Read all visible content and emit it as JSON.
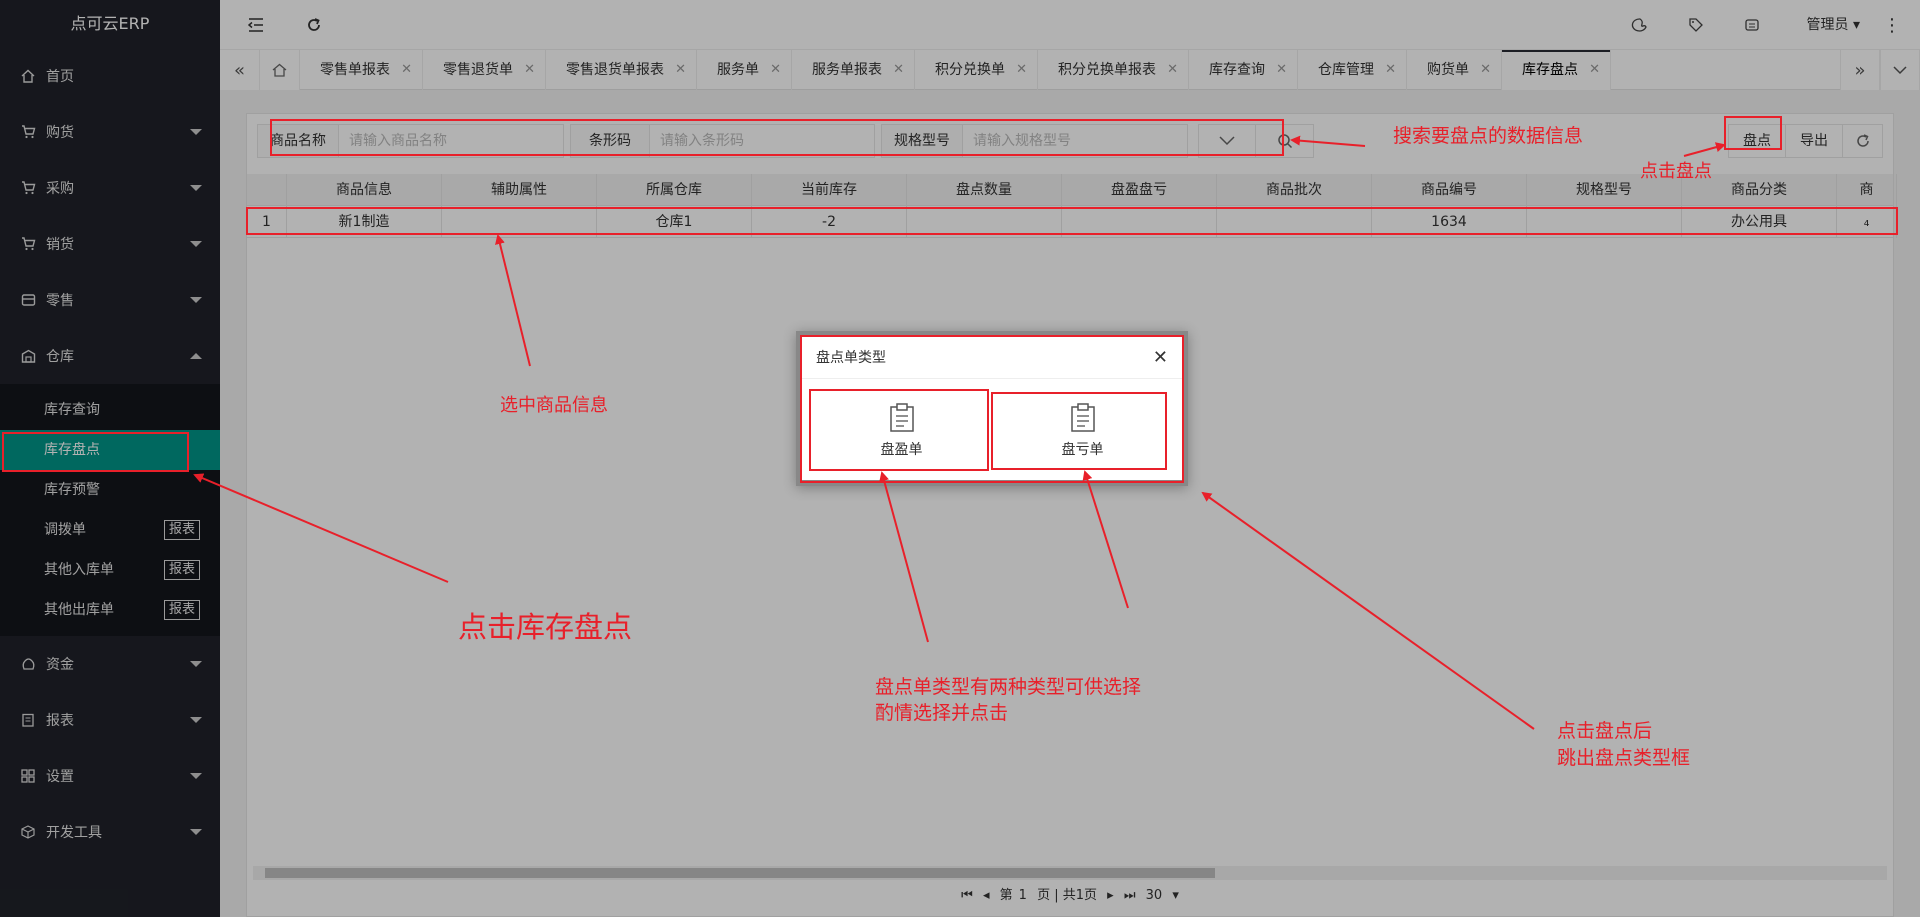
{
  "app": {
    "title": "点可云ERP"
  },
  "sidebar": {
    "items": [
      {
        "label": "首页",
        "icon": "home-icon",
        "expandable": false
      },
      {
        "label": "购货",
        "icon": "cart-icon",
        "expandable": true
      },
      {
        "label": "采购",
        "icon": "cart-icon",
        "expandable": true
      },
      {
        "label": "销货",
        "icon": "cart-icon",
        "expandable": true
      },
      {
        "label": "零售",
        "icon": "store-icon",
        "expandable": true
      },
      {
        "label": "仓库",
        "icon": "warehouse-icon",
        "expandable": true,
        "expanded": true
      }
    ],
    "warehouse_sub": [
      {
        "label": "库存查询"
      },
      {
        "label": "库存盘点",
        "active": true
      },
      {
        "label": "库存预警"
      },
      {
        "label": "调拨单",
        "badge": "报表"
      },
      {
        "label": "其他入库单",
        "badge": "报表"
      },
      {
        "label": "其他出库单",
        "badge": "报表"
      }
    ],
    "items_after": [
      {
        "label": "资金",
        "icon": "money-icon"
      },
      {
        "label": "报表",
        "icon": "report-icon"
      },
      {
        "label": "设置",
        "icon": "grid-icon"
      },
      {
        "label": "开发工具",
        "icon": "cube-icon"
      }
    ]
  },
  "header": {
    "user": "管理员"
  },
  "tabs": [
    "零售单报表",
    "零售退货单",
    "零售退货单报表",
    "服务单",
    "服务单报表",
    "积分兑换单",
    "积分兑换单报表",
    "库存查询",
    "仓库管理",
    "购货单",
    "库存盘点"
  ],
  "search": {
    "name_label": "商品名称",
    "name_placeholder": "请输入商品名称",
    "barcode_label": "条形码",
    "barcode_placeholder": "请输入条形码",
    "spec_label": "规格型号",
    "spec_placeholder": "请输入规格型号"
  },
  "actions": {
    "stocktake": "盘点",
    "export": "导出"
  },
  "table": {
    "headers": [
      "商品信息",
      "辅助属性",
      "所属仓库",
      "当前库存",
      "盘点数量",
      "盘盈盘亏",
      "商品批次",
      "商品编号",
      "规格型号",
      "商品分类",
      "商"
    ],
    "rows": [
      [
        "1",
        "新1制造",
        "",
        "仓库1",
        "-2",
        "",
        "",
        "",
        "1634",
        "",
        "办公用具",
        "₄"
      ]
    ]
  },
  "pager": {
    "page_prefix": "第",
    "page_num": "1",
    "page_suffix": "页 | 共1页",
    "page_size": "30"
  },
  "dialog": {
    "title": "盘点单类型",
    "options": [
      "盘盈单",
      "盘亏单"
    ]
  },
  "annotations": {
    "search_note": "搜索要盘点的数据信息",
    "click_stocktake": "点击盘点",
    "select_product": "选中商品信息",
    "click_inventory": "点击库存盘点",
    "dialog_note_1": "盘点单类型有两种类型可供选择",
    "dialog_note_2": "酌情选择并点击",
    "popup_note_1": "点击盘点后",
    "popup_note_2": "跳出盘点类型框"
  }
}
